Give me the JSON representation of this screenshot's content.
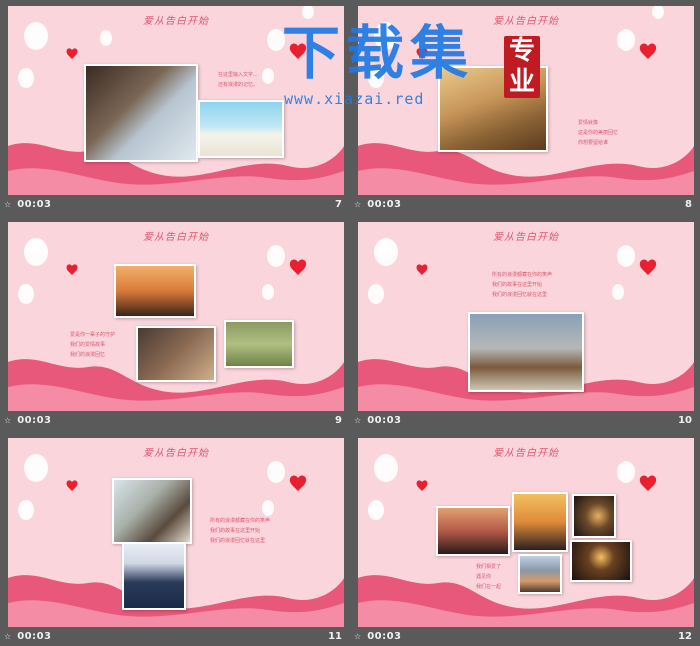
{
  "slide_title": "爱从告白开始",
  "time_label": "00:03",
  "watermark": {
    "main": "下载集",
    "seal": "专业",
    "url": "www.xiazai.red"
  },
  "slides": [
    {
      "number": "7",
      "texts": [
        "在这里输入文字...\n还有浪漫的记忆。"
      ],
      "photos": [
        "couple-on-rock-photo",
        "beach-couple-photo"
      ]
    },
    {
      "number": "8",
      "texts": [
        "爱情就像\n这是你的美丽回忆\n你想要留给谁"
      ],
      "photos": [
        "couple-in-grass-photo"
      ]
    },
    {
      "number": "9",
      "texts": [
        "爱是你一辈子的守护\n我们的爱情故事\n我们的浪漫回忆"
      ],
      "photos": [
        "sunset-silhouette-photo",
        "embrace-photo",
        "picnic-couple-photo"
      ]
    },
    {
      "number": "10",
      "texts": [
        "所有的浪漫都藏在你的笑声\n我们的故事在这里开始\n我们的浪漫回忆就在这里"
      ],
      "photos": [
        "couple-shoes-photo"
      ]
    },
    {
      "number": "11",
      "texts": [
        "所有的浪漫都藏在你的笑声\n我们的故事在这里开始\n我们的浪漫回忆就在这里"
      ],
      "photos": [
        "girl-hair-photo",
        "boy-suit-photo"
      ]
    },
    {
      "number": "12",
      "texts": [
        "我们相爱了\n遇见你\n我们在一起"
      ],
      "photos": [
        "bicycle-sunset-photo",
        "kiss-sunset-photo",
        "bokeh-couple-photo",
        "lake-mountain-photo",
        "sparkler-photo"
      ]
    }
  ],
  "colors": {
    "slide_bg": "#fbd5dc",
    "wave_dark": "#e8587a",
    "wave_light": "#f38ca4",
    "heart": "#e8202f",
    "title": "#e2566e",
    "watermark_blue": "#1e79e6",
    "seal_red": "#c01a22"
  }
}
